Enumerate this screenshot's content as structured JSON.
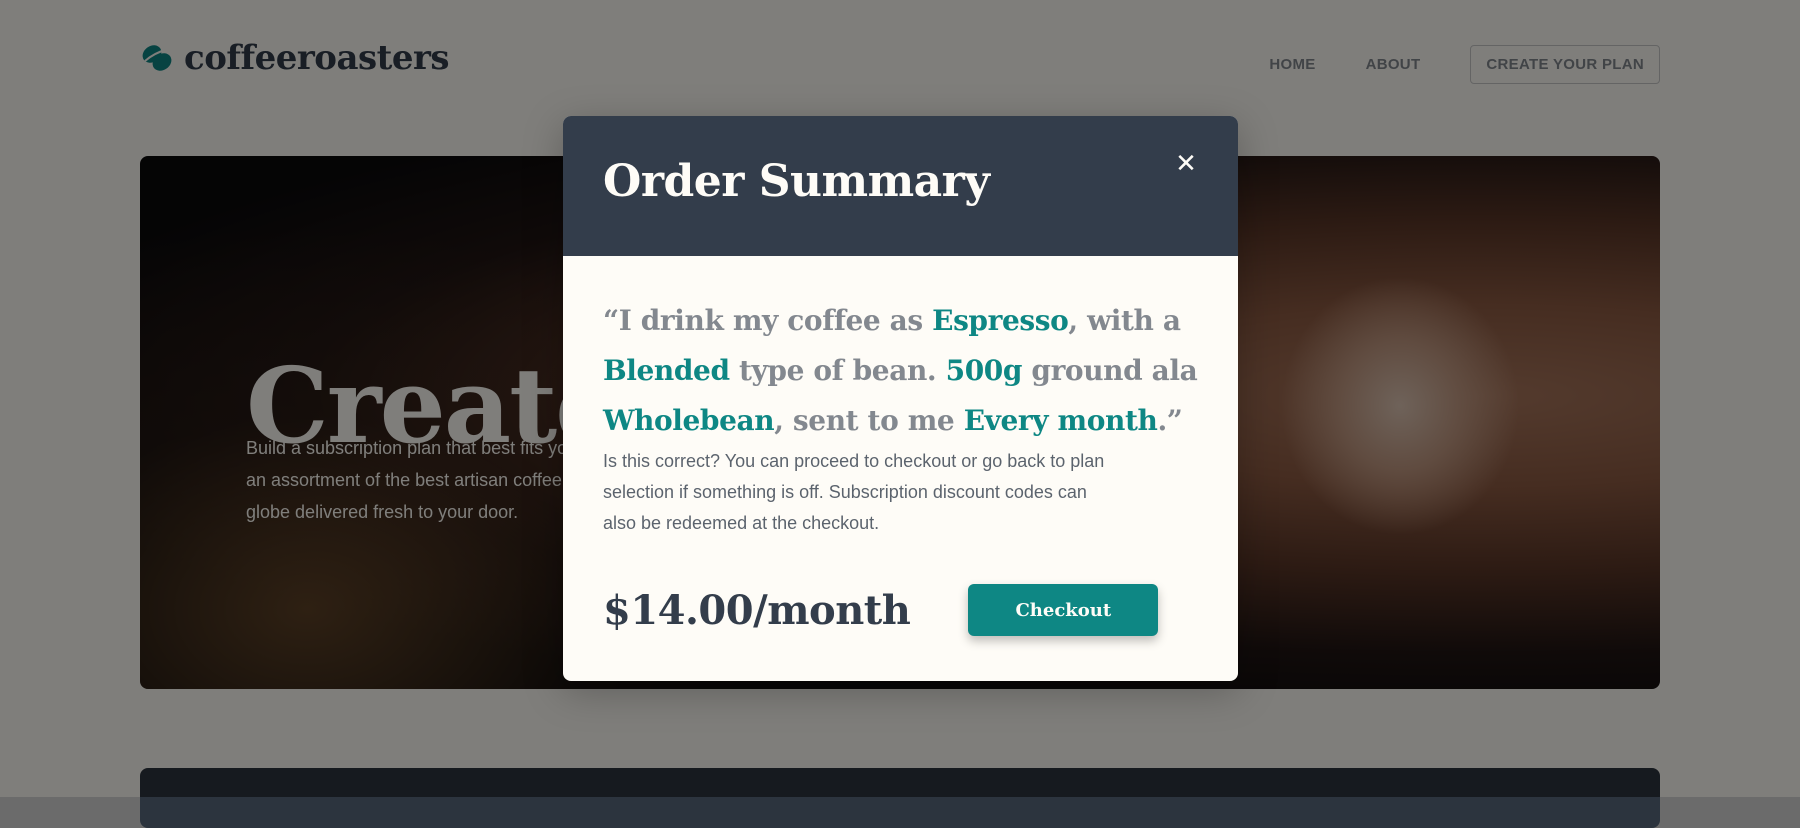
{
  "header": {
    "logo_text": "coffeeroasters",
    "logo_icon": "coffee-bean-icon",
    "nav": {
      "home": "HOME",
      "about": "ABOUT",
      "create_plan": "CREATE YOUR PLAN"
    }
  },
  "hero": {
    "title": "Create",
    "text": "Build a subscription plan that best fits your needs. We offer an assortment of the best artisan coffee from around the globe delivered fresh to your door."
  },
  "modal": {
    "title": "Order Summary",
    "close_icon": "close-icon",
    "summary": {
      "p1": "“I drink my coffee as ",
      "drink": "Espresso",
      "p2": ", with a ",
      "bean": "Blended",
      "p3": " type of bean. ",
      "quantity": "500g",
      "p4": " ground ala ",
      "grind": "Wholebean",
      "p5": ", sent to me ",
      "frequency": "Every month",
      "p6": ".”"
    },
    "note": "Is this correct? You can proceed to checkout or go back to plan selection if something is off. Subscription discount codes can also be redeemed at the checkout.",
    "price": "$14.00/month",
    "checkout_label": "Checkout"
  },
  "colors": {
    "accent": "#0e8784",
    "dark": "#333d4b",
    "grey": "#83888f",
    "light": "#fefcf7"
  }
}
